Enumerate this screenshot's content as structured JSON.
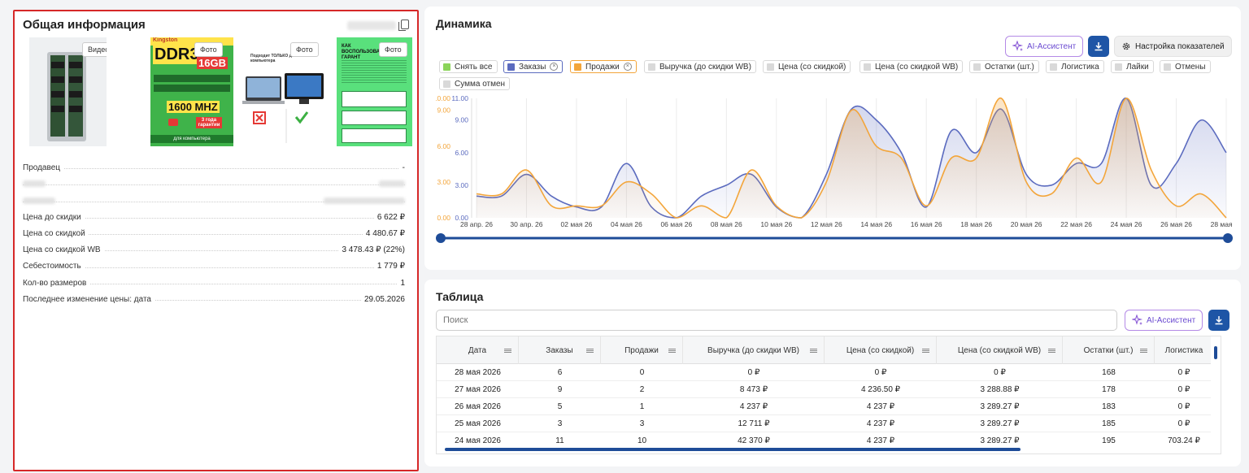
{
  "info": {
    "title": "Общая информация",
    "media": [
      {
        "badge": "Видео",
        "icon": "ram-photo"
      },
      {
        "badge": "Фото",
        "icon": "ddr3-banner",
        "brand": "Kingston",
        "text_main": "DDR3",
        "text_size": "16GB",
        "text_freq": "1600 MHZ",
        "text_warranty": "3 года гарантии",
        "text_bottom": "для компьютера"
      },
      {
        "badge": "Фото",
        "icon": "compat-banner",
        "text_top": "Подходит ТОЛЬКО для компьютера"
      },
      {
        "badge": "Фото",
        "icon": "howto-banner",
        "text_top": "КАК ВОСПОЛЬЗОВАТЬСЯ ГАРАНТ"
      }
    ],
    "props": [
      {
        "label": "Продавец",
        "value": "-"
      },
      {
        "label": "",
        "value": "",
        "blurred": true
      },
      {
        "label": "",
        "value": "",
        "blurred": true
      },
      {
        "label": "Цена до скидки",
        "value": "6 622 ₽"
      },
      {
        "label": "Цена со скидкой",
        "value": "4 480.67 ₽"
      },
      {
        "label": "Цена со скидкой WB",
        "value": "3 478.43 ₽ (22%)"
      },
      {
        "label": "Себестоимость",
        "value": "1 779 ₽"
      },
      {
        "label": "Кол-во размеров",
        "value": "1"
      },
      {
        "label": "Последнее изменение цены: дата",
        "value": "29.05.2026"
      }
    ]
  },
  "dynamics": {
    "title": "Динамика",
    "ai_button": "AI-Ассистент",
    "settings_button": "Настройка показателей",
    "chips": [
      {
        "label": "Снять все",
        "color": "#8bd45a",
        "closable": false
      },
      {
        "label": "Заказы",
        "color": "#5b6bbf",
        "closable": true,
        "active": true
      },
      {
        "label": "Продажи",
        "color": "#f3a53a",
        "closable": true,
        "active": true
      },
      {
        "label": "Выручка (до скидки WB)",
        "color": "#d9d9d9"
      },
      {
        "label": "Цена (со скидкой)",
        "color": "#d9d9d9"
      },
      {
        "label": "Цена (со скидкой WB)",
        "color": "#d9d9d9"
      },
      {
        "label": "Остатки (шт.)",
        "color": "#d9d9d9"
      },
      {
        "label": "Логистика",
        "color": "#d9d9d9"
      },
      {
        "label": "Лайки",
        "color": "#d9d9d9"
      },
      {
        "label": "Отмены",
        "color": "#d9d9d9"
      },
      {
        "label": "Сумма отмен",
        "color": "#d9d9d9"
      }
    ]
  },
  "chart_data": {
    "type": "area",
    "x_ticks": [
      "28 апр. 26",
      "30 апр. 26",
      "02 мая 26",
      "04 мая 26",
      "06 мая 26",
      "08 мая 26",
      "10 мая 26",
      "12 мая 26",
      "14 мая 26",
      "16 мая 26",
      "18 мая 26",
      "20 мая 26",
      "22 мая 26",
      "24 мая 26",
      "26 мая 26",
      "28 мая 26"
    ],
    "left_axis": {
      "ticks": [
        "0.00",
        "3.00",
        "6.00",
        "9.00",
        "10.00"
      ],
      "color": "#f3a53a",
      "max": 10
    },
    "right_axis": {
      "ticks": [
        "0.00",
        "3.00",
        "6.00",
        "9.00",
        "11.00"
      ],
      "color": "#5b6bbf",
      "max": 11
    },
    "series": [
      {
        "name": "Заказы",
        "color": "#5b6bbf",
        "axis": "right",
        "values": [
          2,
          2,
          4,
          2,
          1,
          1,
          5,
          1,
          0,
          2,
          3,
          4,
          1,
          0,
          4,
          10,
          9,
          6,
          1,
          8,
          6,
          10,
          4,
          3,
          5,
          5,
          11,
          3,
          5,
          9,
          6
        ]
      },
      {
        "name": "Продажи",
        "color": "#f3a53a",
        "axis": "left",
        "values": [
          2,
          2,
          4,
          1,
          1,
          1,
          3,
          2,
          0,
          1,
          0,
          4,
          1,
          0,
          3,
          9,
          6,
          5,
          1,
          5,
          5,
          10,
          3,
          2,
          5,
          3,
          10,
          4,
          1,
          2,
          0
        ]
      }
    ]
  },
  "table": {
    "title": "Таблица",
    "search_placeholder": "Поиск",
    "ai_button": "AI-Ассистент",
    "columns": [
      "Дата",
      "Заказы",
      "Продажи",
      "Выручка (до скидки WB)",
      "Цена (со скидкой)",
      "Цена (со скидкой WB)",
      "Остатки (шт.)",
      "Логистика"
    ],
    "rows": [
      [
        "28 мая 2026",
        "6",
        "0",
        "0 ₽",
        "0 ₽",
        "0 ₽",
        "168",
        "0 ₽"
      ],
      [
        "27 мая 2026",
        "9",
        "2",
        "8 473 ₽",
        "4 236.50 ₽",
        "3 288.88 ₽",
        "178",
        "0 ₽"
      ],
      [
        "26 мая 2026",
        "5",
        "1",
        "4 237 ₽",
        "4 237 ₽",
        "3 289.27 ₽",
        "183",
        "0 ₽"
      ],
      [
        "25 мая 2026",
        "3",
        "3",
        "12 711 ₽",
        "4 237 ₽",
        "3 289.27 ₽",
        "185",
        "0 ₽"
      ],
      [
        "24 мая 2026",
        "11",
        "10",
        "42 370 ₽",
        "4 237 ₽",
        "3 289.27 ₽",
        "195",
        "703.24 ₽"
      ]
    ]
  }
}
